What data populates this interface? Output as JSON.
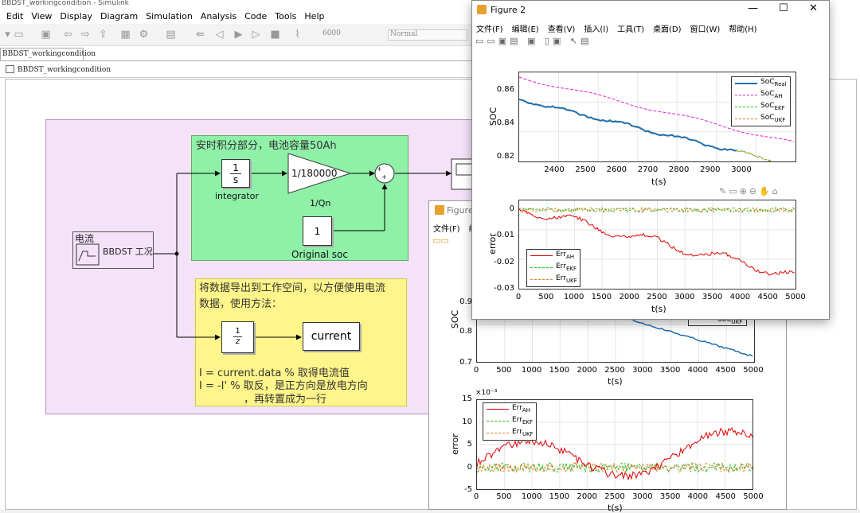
{
  "simulink": {
    "title": "BBDST_workingcondition - Simulink",
    "menu": [
      "Edit",
      "View",
      "Display",
      "Diagram",
      "Simulation",
      "Analysis",
      "Code",
      "Tools",
      "Help"
    ],
    "stop_time": "6000",
    "sim_mode": "Normal",
    "tab": "BBDST_workingcondition",
    "breadcrumb": "BBDST_workingcondition"
  },
  "model": {
    "green_title": "安时积分部分，电池容量50Ah",
    "integrator": {
      "top": "1",
      "bottom": "s",
      "label": "integrator"
    },
    "gain": {
      "value": "1/180000",
      "label": "1/Qn"
    },
    "constant": {
      "value": "1",
      "label": "Original soc"
    },
    "sum_signs": [
      "+",
      "+"
    ],
    "source": {
      "title": "电流",
      "name": "BBDST 工况"
    },
    "yellow_text": [
      "将数据导出到工作空间，以方便使用电流",
      "数据，使用方法：",
      "I = current.data  % 取得电流值",
      "I = -I'  % 取反，是正方向是放电方向",
      "，再转置成为一行"
    ],
    "delay": {
      "top": "1",
      "bottom": "z"
    },
    "to_workspace": "current"
  },
  "figure2": {
    "title": "Figure 2",
    "menu": [
      "文件(F)",
      "编辑(E)",
      "查看(V)",
      "插入(I)",
      "工具(T)",
      "桌面(D)",
      "窗口(W)",
      "帮助(H)"
    ],
    "soc_plot": {
      "ylabel": "SOC",
      "xlabel": "t(s)",
      "yticks": [
        "0.86",
        "0.84",
        "0.82"
      ],
      "xticks": [
        "2400",
        "2500",
        "2600",
        "2700",
        "2800",
        "2900",
        "3000"
      ],
      "legend": [
        "SoC",
        "SoC",
        "SoC",
        "SoC"
      ],
      "legend_sub": [
        "Real",
        "AH",
        "EKF",
        "UKF"
      ]
    },
    "err_plot": {
      "ylabel": "error",
      "xlabel": "t(s)",
      "yticks": [
        "0",
        "-0.01",
        "-0.02",
        "-0.03"
      ],
      "xticks": [
        "0",
        "500",
        "1000",
        "1500",
        "2000",
        "2500",
        "3000",
        "3500",
        "4000",
        "4500",
        "5000"
      ],
      "legend": [
        "Err",
        "Err",
        "Err"
      ],
      "legend_sub": [
        "AH",
        "EKF",
        "UKF"
      ]
    }
  },
  "figure1": {
    "title": "Figure 1",
    "menu": [
      "文件(F)",
      "编"
    ],
    "soc_plot": {
      "ylabel": "SOC",
      "xlabel": "t(s)",
      "yticks": [
        "0.9",
        "0.8",
        "0.7"
      ],
      "xticks": [
        "0",
        "500",
        "1000",
        "1500",
        "2000",
        "2500",
        "3000",
        "3500",
        "4000",
        "4500",
        "5000"
      ],
      "legend_partial": "SoC",
      "legend_partial_sub": "UKF"
    },
    "err_plot": {
      "ylabel": "error",
      "xlabel": "t(s)",
      "exponent": "×10⁻³",
      "yticks": [
        "15",
        "10",
        "5",
        "0",
        "-5"
      ],
      "xticks": [
        "0",
        "500",
        "1000",
        "1500",
        "2000",
        "2500",
        "3000",
        "3500",
        "4000",
        "4500",
        "5000"
      ],
      "legend": [
        "Err",
        "Err",
        "Err"
      ],
      "legend_sub": [
        "AH",
        "EKF",
        "UKF"
      ]
    }
  },
  "colors": {
    "real": "#1f6fb2",
    "ah": "#e020d0",
    "ekf": "#20c020",
    "ukf": "#e08020",
    "err_ah": "#e00000"
  }
}
